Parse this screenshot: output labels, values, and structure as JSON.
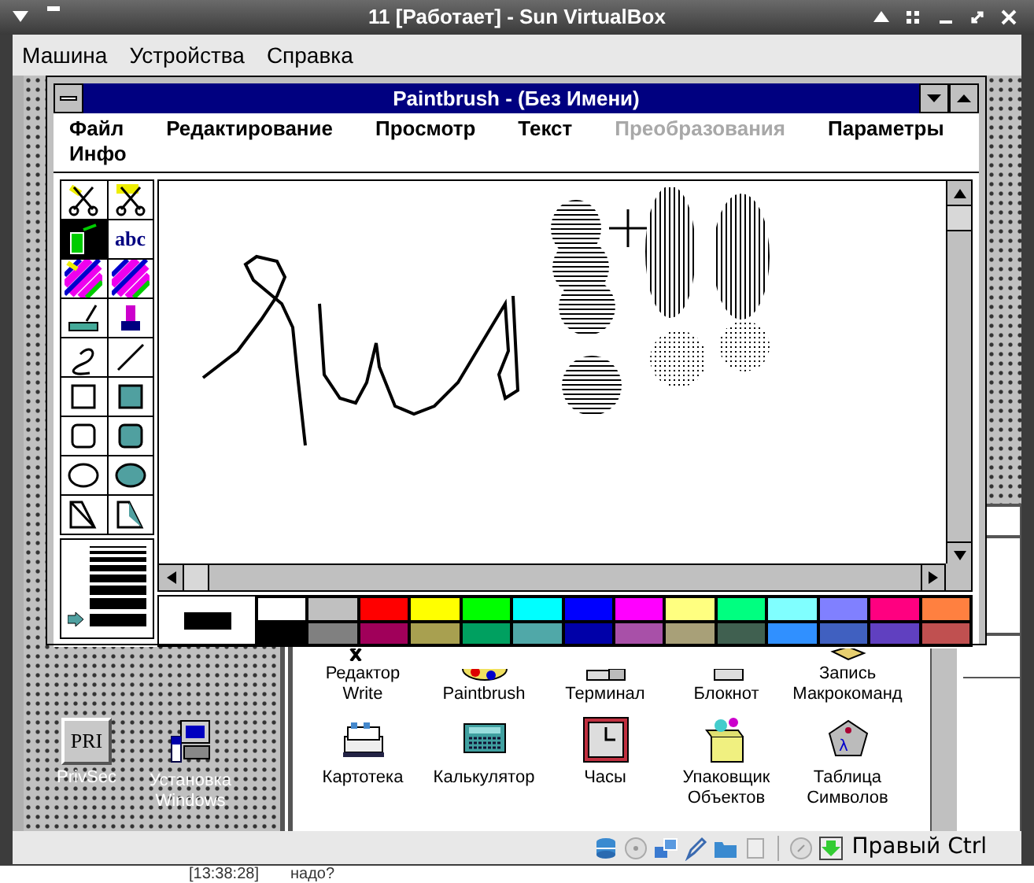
{
  "vbox_window": {
    "title": "11 [Работает] - Sun VirtualBox",
    "menu": [
      "Машина",
      "Устройства",
      "Справка"
    ]
  },
  "paintbrush": {
    "title": "Paintbrush - (Без Имени)",
    "menu": [
      {
        "label": "Файл",
        "disabled": false
      },
      {
        "label": "Редактирование",
        "disabled": false
      },
      {
        "label": "Просмотр",
        "disabled": false
      },
      {
        "label": "Текст",
        "disabled": false
      },
      {
        "label": "Преобразования",
        "disabled": true
      },
      {
        "label": "Параметры",
        "disabled": false
      },
      {
        "label": "Инфо",
        "disabled": false
      }
    ],
    "tools": [
      {
        "kind": "scissors",
        "selected": false
      },
      {
        "kind": "pick",
        "selected": false
      },
      {
        "kind": "airbrush",
        "selected": true
      },
      {
        "kind": "text",
        "selected": false,
        "icon_text": "abc"
      },
      {
        "kind": "color-eraser",
        "selected": false
      },
      {
        "kind": "eraser",
        "selected": false
      },
      {
        "kind": "roller",
        "selected": false
      },
      {
        "kind": "brush",
        "selected": false
      },
      {
        "kind": "curve",
        "selected": false
      },
      {
        "kind": "line",
        "selected": false
      },
      {
        "kind": "box",
        "selected": false
      },
      {
        "kind": "filled-box",
        "selected": false
      },
      {
        "kind": "rounded-box",
        "selected": false
      },
      {
        "kind": "filled-rounded-box",
        "selected": false
      },
      {
        "kind": "circle",
        "selected": false
      },
      {
        "kind": "filled-circle",
        "selected": false
      },
      {
        "kind": "polygon",
        "selected": false
      },
      {
        "kind": "filled-polygon",
        "selected": false
      }
    ],
    "line_widths": [
      {
        "selected": false
      },
      {
        "selected": false
      },
      {
        "selected": false
      },
      {
        "selected": false
      },
      {
        "selected": false
      },
      {
        "selected": false
      },
      {
        "selected": false
      },
      {
        "selected": true
      }
    ],
    "palette": [
      {
        "color": "#ffffff"
      },
      {
        "color": "#000000"
      },
      {
        "color": "#c0c0c0"
      },
      {
        "color": "#808080"
      },
      {
        "color": "#ff0000"
      },
      {
        "color": "#a0005a"
      },
      {
        "color": "#ffff00"
      },
      {
        "color": "#a8a050"
      },
      {
        "color": "#00ff00"
      },
      {
        "color": "#00a060"
      },
      {
        "color": "#00ffff"
      },
      {
        "color": "#50a8a8"
      },
      {
        "color": "#0000ff"
      },
      {
        "color": "#0000a8"
      },
      {
        "color": "#ff00ff"
      },
      {
        "color": "#a850a8"
      },
      {
        "color": "#ffff80"
      },
      {
        "color": "#a8a078"
      },
      {
        "color": "#00ff80"
      },
      {
        "color": "#406050"
      },
      {
        "color": "#80ffff"
      },
      {
        "color": "#3090ff"
      },
      {
        "color": "#8080ff"
      },
      {
        "color": "#4060c0"
      },
      {
        "color": "#ff0080"
      },
      {
        "color": "#6040c0"
      },
      {
        "color": "#ff8040"
      },
      {
        "color": "#c05050"
      }
    ]
  },
  "program_group": {
    "items": [
      {
        "label": "Редактор Write",
        "kind": "write"
      },
      {
        "label": "Paintbrush",
        "kind": "paint"
      },
      {
        "label": "Терминал",
        "kind": "terminal"
      },
      {
        "label": "Блокнот",
        "kind": "notepad"
      },
      {
        "label": "Запись Макрокоманд",
        "kind": "recorder"
      },
      {
        "label": "Картотека",
        "kind": "cardfile"
      },
      {
        "label": "Калькулятор",
        "kind": "calculator"
      },
      {
        "label": "Часы",
        "kind": "clock"
      },
      {
        "label": "Упаковщик Объектов",
        "kind": "packager"
      },
      {
        "label": "Таблица Символов",
        "kind": "charmap",
        "icon_text": "λ"
      }
    ]
  },
  "desktop_icons": [
    {
      "label": "PrivSec",
      "kind": "pri",
      "icon_text": "PRI"
    },
    {
      "label": "Установка Windows",
      "kind": "setup"
    }
  ],
  "status_bar": {
    "host_key": "Правый Ctrl"
  },
  "background_text": [
    "[13:38:28]",
    "надо?"
  ]
}
